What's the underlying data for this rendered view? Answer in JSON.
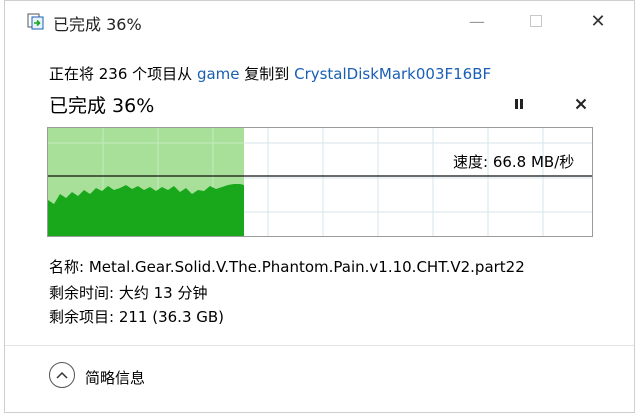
{
  "window": {
    "title": "已完成 36%",
    "minimize_glyph": "—",
    "close_glyph": "✕"
  },
  "copy": {
    "prefix": "正在将 236 个项目从",
    "source": "game",
    "middle": "复制到",
    "destination": "CrystalDiskMark003F16BF",
    "progress_heading": "已完成 36%",
    "progress_fraction": 0.36,
    "speed_label": "速度: 66.8 MB/秒"
  },
  "details": {
    "name_label": "名称:",
    "name_value": "Metal.Gear.Solid.V.The.Phantom.Pain.v1.10.CHT.V2.part22",
    "time_label": "剩余时间:",
    "time_value": "大约 13 分钟",
    "items_label": "剩余项目:",
    "items_value": "211 (36.3 GB)"
  },
  "footer": {
    "toggle_label": "简略信息"
  },
  "colors": {
    "accent": "#1a5fb4",
    "graph_fill_light": "#a8e09a",
    "graph_fill_dark": "#19a81c",
    "grid": "#d7e6ee"
  },
  "icons": [
    "copy-progress-icon",
    "pause-icon",
    "cancel-icon",
    "chevron-up-icon"
  ]
}
